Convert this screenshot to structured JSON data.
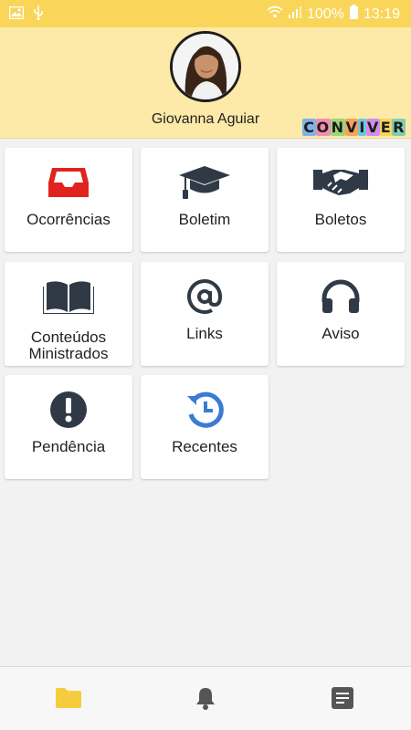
{
  "status_bar": {
    "battery": "100%",
    "time": "13:19",
    "icons": [
      "image-icon",
      "usb-icon",
      "wifi-icon",
      "signal-icon",
      "battery-icon"
    ]
  },
  "profile": {
    "name": "Giovanna Aguiar",
    "brand": "CONVIVER",
    "brand_colors": [
      "#7fb3e8",
      "#f28db2",
      "#9bd67a",
      "#f7a25a",
      "#6ec6e0",
      "#d08fe6",
      "#f7d35a",
      "#7fd0b0"
    ]
  },
  "tiles": [
    {
      "label": "Ocorrências",
      "icon": "inbox-icon",
      "icon_color": "#e0231f"
    },
    {
      "label": "Boletim",
      "icon": "graduation-cap-icon",
      "icon_color": "#2f3a46"
    },
    {
      "label": "Boletos",
      "icon": "handshake-icon",
      "icon_color": "#2f3a46"
    },
    {
      "label": "Conteúdos Ministrados",
      "icon": "open-book-icon",
      "icon_color": "#2f3a46"
    },
    {
      "label": "Links",
      "icon": "at-sign-icon",
      "icon_color": "#2f3a46"
    },
    {
      "label": "Aviso",
      "icon": "headphones-icon",
      "icon_color": "#2f3a46"
    },
    {
      "label": "Pendência",
      "icon": "exclamation-circle-icon",
      "icon_color": "#2f3a46"
    },
    {
      "label": "Recentes",
      "icon": "history-icon",
      "icon_color": "#3a7bd5"
    }
  ],
  "bottom_nav": [
    {
      "icon": "folder-icon",
      "color": "#f5cc3d",
      "active": true
    },
    {
      "icon": "bell-icon",
      "color": "#555555",
      "active": false
    },
    {
      "icon": "document-icon",
      "color": "#555555",
      "active": false
    }
  ]
}
